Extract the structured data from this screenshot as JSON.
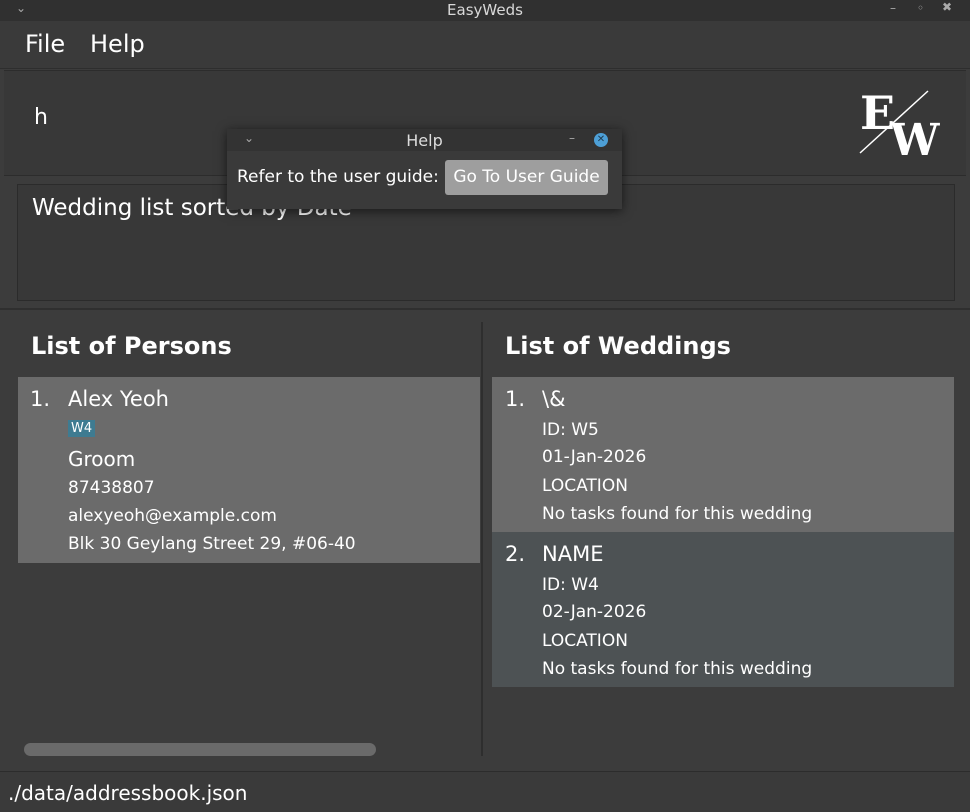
{
  "window": {
    "title": "EasyWeds"
  },
  "menu": {
    "file": "File",
    "help": "Help"
  },
  "command": {
    "text": "h"
  },
  "result": {
    "text": "Wedding list sorted by Date"
  },
  "persons": {
    "title": "List of Persons",
    "items": [
      {
        "index": "1.",
        "name": "Alex Yeoh",
        "tag": "W4",
        "role": "Groom",
        "phone": "87438807",
        "email": "alexyeoh@example.com",
        "address": "Blk 30 Geylang Street 29, #06-40"
      }
    ]
  },
  "weddings": {
    "title": "List of Weddings",
    "items": [
      {
        "index": "1.",
        "name": "\\&",
        "id": "ID: W5",
        "date": "01-Jan-2026",
        "location": "LOCATION",
        "tasks": "No tasks found for this wedding"
      },
      {
        "index": "2.",
        "name": "NAME",
        "id": "ID: W4",
        "date": "02-Jan-2026",
        "location": "LOCATION",
        "tasks": "No tasks found for this wedding"
      }
    ]
  },
  "status": {
    "path": "./data/addressbook.json"
  },
  "help_dialog": {
    "title": "Help",
    "text": "Refer to the user guide:",
    "button": "Go To User Guide"
  },
  "logo": {
    "letters": "EW"
  },
  "colors": {
    "background": "#3c3c3c",
    "card_selected": "#6b6b6b",
    "card_normal": "#4d5254",
    "tag": "#3e7b91",
    "help_button": "#9e9e9e"
  }
}
